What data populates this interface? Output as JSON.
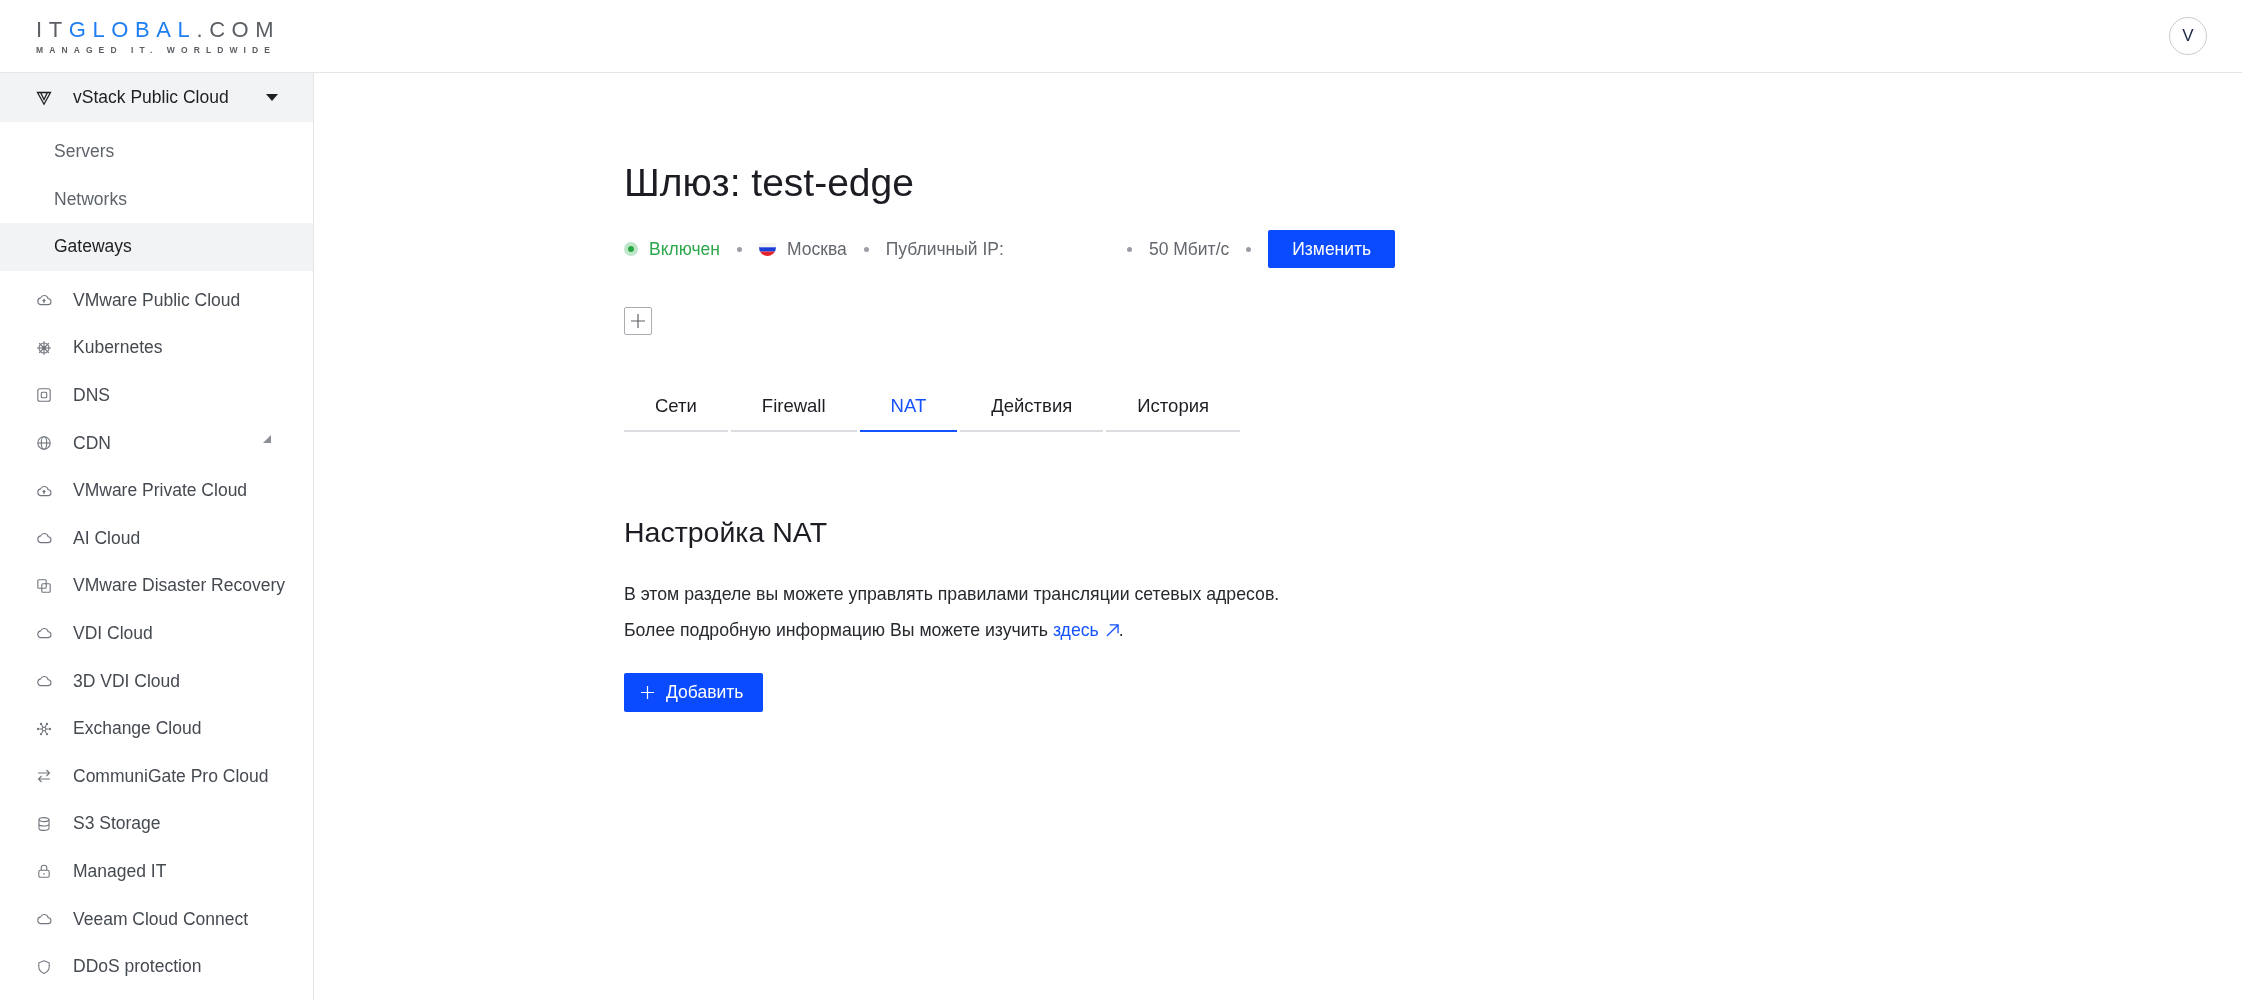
{
  "header": {
    "logo": {
      "parts": [
        {
          "text": "IT",
          "accent": false
        },
        {
          "text": "GLOBAL",
          "accent": true
        },
        {
          "text": ".COM",
          "accent": false
        }
      ],
      "tagline": "MANAGED IT. WORLDWIDE"
    },
    "avatar": "V"
  },
  "sidebar": {
    "items": [
      {
        "kind": "group",
        "label": "vStack Public Cloud",
        "expanded": true,
        "children": [
          {
            "label": "Servers",
            "selected": false
          },
          {
            "label": "Networks",
            "selected": false
          },
          {
            "label": "Gateways",
            "selected": true
          }
        ]
      },
      {
        "kind": "link",
        "label": "VMware Public Cloud"
      },
      {
        "kind": "link",
        "label": "Kubernetes"
      },
      {
        "kind": "link",
        "label": "DNS"
      },
      {
        "kind": "group",
        "label": "CDN",
        "expanded": false
      },
      {
        "kind": "link",
        "label": "VMware Private Cloud"
      },
      {
        "kind": "link",
        "label": "AI Cloud"
      },
      {
        "kind": "link",
        "label": "VMware Disaster Recovery"
      },
      {
        "kind": "link",
        "label": "VDI Cloud"
      },
      {
        "kind": "link",
        "label": "3D VDI Cloud"
      },
      {
        "kind": "link",
        "label": "Exchange Cloud"
      },
      {
        "kind": "link",
        "label": "CommuniGate Pro Cloud"
      },
      {
        "kind": "link",
        "label": "S3 Storage"
      },
      {
        "kind": "link",
        "label": "Managed IT"
      },
      {
        "kind": "link",
        "label": "Veeam Cloud Connect"
      },
      {
        "kind": "link",
        "label": "DDoS protection"
      }
    ]
  },
  "gateway": {
    "title": "Шлюз: test-edge",
    "status": {
      "label": "Включен",
      "on": true
    },
    "location": "Москва",
    "public_ip_label": "Публичный IP:",
    "bandwidth": "50 Мбит/с",
    "edit_button": "Изменить"
  },
  "tabs": [
    {
      "label": "Сети",
      "selected": false
    },
    {
      "label": "Firewall",
      "selected": false
    },
    {
      "label": "NAT",
      "selected": true
    },
    {
      "label": "Действия",
      "selected": false
    },
    {
      "label": "История",
      "selected": false
    }
  ],
  "nat": {
    "title": "Настройка NAT",
    "description": "В этом разделе вы можете управлять правилами трансляции сетевых адресов.",
    "more_info": {
      "text": "Более подробную информацию Вы можете изучить",
      "link": "здесь",
      "after": "."
    },
    "add_button": "Добавить"
  }
}
